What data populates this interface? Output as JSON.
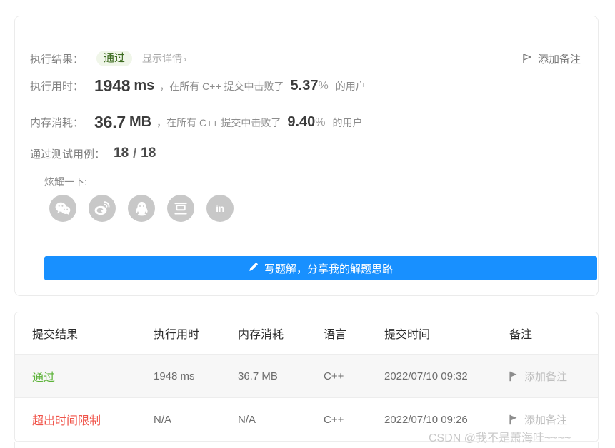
{
  "result_card": {
    "status_label": "执行结果：",
    "status_badge": "通过",
    "detail_link": "显示详情",
    "detail_chevron": "›",
    "add_note_top": "添加备注",
    "runtime_label": "执行用时：",
    "runtime_value": "1948",
    "runtime_unit": "ms",
    "runtime_mid": "，在所有 C++ 提交中击败了",
    "runtime_percent": "5.37",
    "percent_sign": "%",
    "runtime_suffix": "的用户",
    "memory_label": "内存消耗：",
    "memory_value": "36.7",
    "memory_unit": "MB",
    "memory_mid": "，在所有 C++ 提交中击败了",
    "memory_percent": "9.40",
    "memory_suffix": "的用户",
    "cases_label": "通过测试用例：",
    "cases_passed": "18",
    "cases_separator": "/",
    "cases_total": "18",
    "share_label": "炫耀一下:",
    "share_buttons": [
      {
        "name": "wechat-icon",
        "title": "微信"
      },
      {
        "name": "weibo-icon",
        "title": "微博"
      },
      {
        "name": "qq-icon",
        "title": "QQ"
      },
      {
        "name": "douban-icon",
        "title": "豆瓣"
      },
      {
        "name": "linkedin-icon",
        "title": "in"
      }
    ],
    "write_button": "写题解，分享我的解题思路",
    "write_button_icon": "pencil-icon",
    "button_color": "#1890ff",
    "badge_text_color": "#3c6b1f",
    "badge_bg_color": "#f0f6e9"
  },
  "submissions": {
    "columns": [
      "提交结果",
      "执行用时",
      "内存消耗",
      "语言",
      "提交时间",
      "备注"
    ],
    "rows": [
      {
        "result": "通过",
        "result_color": "#5cb338",
        "runtime": "1948 ms",
        "memory": "36.7 MB",
        "language": "C++",
        "submitted_at": "2022/07/10 09:32",
        "note": "添加备注"
      },
      {
        "result": "超出时间限制",
        "result_color": "#f0544a",
        "runtime": "N/A",
        "memory": "N/A",
        "language": "C++",
        "submitted_at": "2022/07/10 09:26",
        "note": "添加备注"
      }
    ]
  },
  "watermark": "CSDN @我不是萧海哇~~~~"
}
